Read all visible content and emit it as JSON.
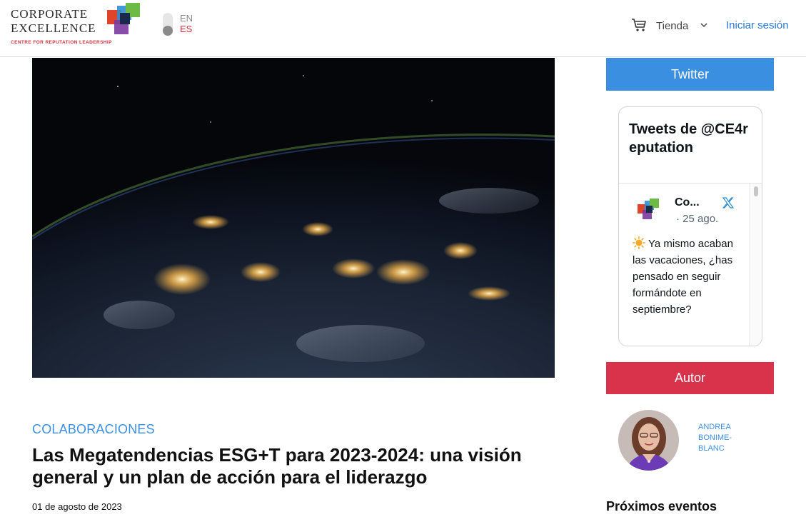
{
  "header": {
    "logo": {
      "line1": "CORPORATE",
      "line2": "EXCELLENCE",
      "tagline": "CENTRE FOR REPUTATION LEADERSHIP"
    },
    "language": {
      "en": "EN",
      "es": "ES",
      "active": "ES"
    },
    "shop_label": "Tienda",
    "login_label": "Iniciar sesión"
  },
  "article": {
    "category": "COLABORACIONES",
    "title": "Las Megatendencias ESG+T para 2023-2024: una visión general y un plan de acción para el liderazgo",
    "date": "01 de agosto de 2023",
    "image_icon": "earth-night-photo"
  },
  "sidebar": {
    "twitter_label": "Twitter",
    "tweets_header": "Tweets de @CE4reputation",
    "tweet": {
      "author_short": "Co...",
      "date": "· 25 ago.",
      "text": "Ya mismo acaban las vacaciones, ¿has pensado en seguir formándote en septiembre?",
      "icon": "sun-emoji"
    },
    "author_label": "Autor",
    "author_name": "ANDREA BONIME-BLANC",
    "events_title": "Próximos eventos"
  },
  "colors": {
    "twitter_blue": "#3b8fe0",
    "author_red": "#d8334a",
    "link_blue": "#2b78d4",
    "brand_red": "#d6303f"
  }
}
